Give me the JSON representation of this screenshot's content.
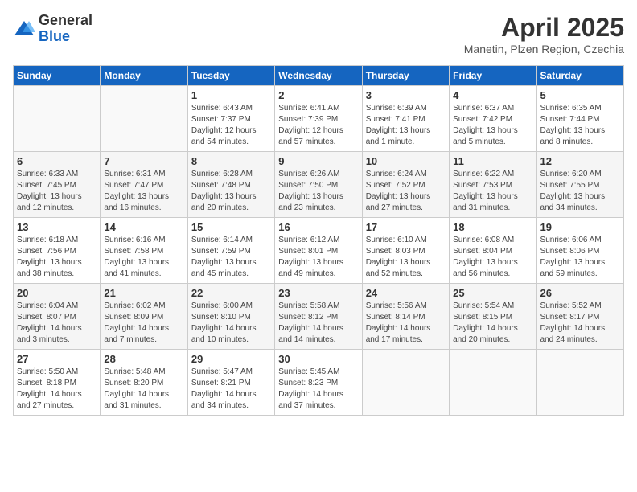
{
  "logo": {
    "general": "General",
    "blue": "Blue"
  },
  "title": "April 2025",
  "location": "Manetin, Plzen Region, Czechia",
  "days_of_week": [
    "Sunday",
    "Monday",
    "Tuesday",
    "Wednesday",
    "Thursday",
    "Friday",
    "Saturday"
  ],
  "weeks": [
    [
      {
        "num": "",
        "info": ""
      },
      {
        "num": "",
        "info": ""
      },
      {
        "num": "1",
        "info": "Sunrise: 6:43 AM\nSunset: 7:37 PM\nDaylight: 12 hours and 54 minutes."
      },
      {
        "num": "2",
        "info": "Sunrise: 6:41 AM\nSunset: 7:39 PM\nDaylight: 12 hours and 57 minutes."
      },
      {
        "num": "3",
        "info": "Sunrise: 6:39 AM\nSunset: 7:41 PM\nDaylight: 13 hours and 1 minute."
      },
      {
        "num": "4",
        "info": "Sunrise: 6:37 AM\nSunset: 7:42 PM\nDaylight: 13 hours and 5 minutes."
      },
      {
        "num": "5",
        "info": "Sunrise: 6:35 AM\nSunset: 7:44 PM\nDaylight: 13 hours and 8 minutes."
      }
    ],
    [
      {
        "num": "6",
        "info": "Sunrise: 6:33 AM\nSunset: 7:45 PM\nDaylight: 13 hours and 12 minutes."
      },
      {
        "num": "7",
        "info": "Sunrise: 6:31 AM\nSunset: 7:47 PM\nDaylight: 13 hours and 16 minutes."
      },
      {
        "num": "8",
        "info": "Sunrise: 6:28 AM\nSunset: 7:48 PM\nDaylight: 13 hours and 20 minutes."
      },
      {
        "num": "9",
        "info": "Sunrise: 6:26 AM\nSunset: 7:50 PM\nDaylight: 13 hours and 23 minutes."
      },
      {
        "num": "10",
        "info": "Sunrise: 6:24 AM\nSunset: 7:52 PM\nDaylight: 13 hours and 27 minutes."
      },
      {
        "num": "11",
        "info": "Sunrise: 6:22 AM\nSunset: 7:53 PM\nDaylight: 13 hours and 31 minutes."
      },
      {
        "num": "12",
        "info": "Sunrise: 6:20 AM\nSunset: 7:55 PM\nDaylight: 13 hours and 34 minutes."
      }
    ],
    [
      {
        "num": "13",
        "info": "Sunrise: 6:18 AM\nSunset: 7:56 PM\nDaylight: 13 hours and 38 minutes."
      },
      {
        "num": "14",
        "info": "Sunrise: 6:16 AM\nSunset: 7:58 PM\nDaylight: 13 hours and 41 minutes."
      },
      {
        "num": "15",
        "info": "Sunrise: 6:14 AM\nSunset: 7:59 PM\nDaylight: 13 hours and 45 minutes."
      },
      {
        "num": "16",
        "info": "Sunrise: 6:12 AM\nSunset: 8:01 PM\nDaylight: 13 hours and 49 minutes."
      },
      {
        "num": "17",
        "info": "Sunrise: 6:10 AM\nSunset: 8:03 PM\nDaylight: 13 hours and 52 minutes."
      },
      {
        "num": "18",
        "info": "Sunrise: 6:08 AM\nSunset: 8:04 PM\nDaylight: 13 hours and 56 minutes."
      },
      {
        "num": "19",
        "info": "Sunrise: 6:06 AM\nSunset: 8:06 PM\nDaylight: 13 hours and 59 minutes."
      }
    ],
    [
      {
        "num": "20",
        "info": "Sunrise: 6:04 AM\nSunset: 8:07 PM\nDaylight: 14 hours and 3 minutes."
      },
      {
        "num": "21",
        "info": "Sunrise: 6:02 AM\nSunset: 8:09 PM\nDaylight: 14 hours and 7 minutes."
      },
      {
        "num": "22",
        "info": "Sunrise: 6:00 AM\nSunset: 8:10 PM\nDaylight: 14 hours and 10 minutes."
      },
      {
        "num": "23",
        "info": "Sunrise: 5:58 AM\nSunset: 8:12 PM\nDaylight: 14 hours and 14 minutes."
      },
      {
        "num": "24",
        "info": "Sunrise: 5:56 AM\nSunset: 8:14 PM\nDaylight: 14 hours and 17 minutes."
      },
      {
        "num": "25",
        "info": "Sunrise: 5:54 AM\nSunset: 8:15 PM\nDaylight: 14 hours and 20 minutes."
      },
      {
        "num": "26",
        "info": "Sunrise: 5:52 AM\nSunset: 8:17 PM\nDaylight: 14 hours and 24 minutes."
      }
    ],
    [
      {
        "num": "27",
        "info": "Sunrise: 5:50 AM\nSunset: 8:18 PM\nDaylight: 14 hours and 27 minutes."
      },
      {
        "num": "28",
        "info": "Sunrise: 5:48 AM\nSunset: 8:20 PM\nDaylight: 14 hours and 31 minutes."
      },
      {
        "num": "29",
        "info": "Sunrise: 5:47 AM\nSunset: 8:21 PM\nDaylight: 14 hours and 34 minutes."
      },
      {
        "num": "30",
        "info": "Sunrise: 5:45 AM\nSunset: 8:23 PM\nDaylight: 14 hours and 37 minutes."
      },
      {
        "num": "",
        "info": ""
      },
      {
        "num": "",
        "info": ""
      },
      {
        "num": "",
        "info": ""
      }
    ]
  ]
}
